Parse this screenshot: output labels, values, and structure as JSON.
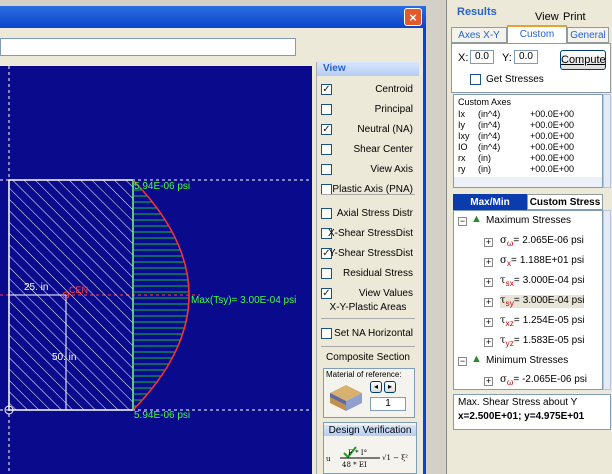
{
  "window": {
    "close_label": "×"
  },
  "canvas": {
    "top_stress": "5.94E-06 psi",
    "bottom_stress": "5.94E-06 psi",
    "max_label": "Max(Tsy)= 3.00E-04 psi",
    "dim_width": "25. in",
    "dim_height": "50. in",
    "na_label": "CEN",
    "colors": {
      "background": "#0a0a8c",
      "section": "#ffffff",
      "fill": "#10c040",
      "curve": "#ff3030"
    }
  },
  "view_panel": {
    "title": "View",
    "items": [
      {
        "label": "Centroid",
        "checked": true
      },
      {
        "label": "Principal",
        "checked": false
      },
      {
        "label": "Neutral (NA)",
        "checked": true
      },
      {
        "label": "Shear Center",
        "checked": false
      },
      {
        "label": "View  Axis",
        "checked": false
      },
      {
        "label": "Plastic Axis (PNA)",
        "checked": false
      },
      {
        "label": "Axial Stress Distr",
        "checked": false
      },
      {
        "label": "X-Shear StressDist",
        "checked": false
      },
      {
        "label": "Y-Shear StressDist",
        "checked": true
      },
      {
        "label": "Residual Stress",
        "checked": false
      },
      {
        "label": "View Values",
        "checked": true
      }
    ],
    "xy_plastic": "X-Y-Plastic Areas",
    "set_na": "Set NA Horizontal",
    "composite": "Composite Section",
    "material_label": "Material of reference:",
    "material_value": "1",
    "design": "Design Verification"
  },
  "right_panel": {
    "results": "Results",
    "view": "View",
    "print": "Print",
    "tabs": [
      "Axes X-Y",
      "Custom axes",
      "General"
    ],
    "x_label": "X:",
    "x_value": "0.0",
    "y_label": "Y:",
    "y_value": "0.0",
    "compute": "Compute",
    "get_stresses": "Get Stresses",
    "custom_axes_title": "Custom Axes",
    "props": [
      {
        "name": "Ix",
        "unit": "(in^4)",
        "value": "+00.0E+00"
      },
      {
        "name": "Iy",
        "unit": "(in^4)",
        "value": "+00.0E+00"
      },
      {
        "name": "Ixy",
        "unit": "(in^4)",
        "value": "+00.0E+00"
      },
      {
        "name": "IO",
        "unit": "(in^4)",
        "value": "+00.0E+00"
      },
      {
        "name": "rx",
        "unit": "(in)",
        "value": "+00.0E+00"
      },
      {
        "name": "ry",
        "unit": "(in)",
        "value": "+00.0E+00"
      }
    ],
    "stress_tabs": [
      "Max/Min Stress",
      "Custom Stress"
    ],
    "max_stresses": "Maximum Stresses",
    "min_stresses": "Minimum Stresses",
    "stresses": [
      {
        "sym": "σ",
        "sub": "ω",
        "eq": "=",
        "value": "2.065E-06 psi"
      },
      {
        "sym": "σ",
        "sub": "x",
        "eq": "=",
        "value": "1.188E+01 psi"
      },
      {
        "sym": "τ",
        "sub": "sx",
        "eq": "=",
        "value": "3.000E-04 psi"
      },
      {
        "sym": "τ",
        "sub": "sy",
        "eq": "=",
        "value": "3.000E-04 psi"
      },
      {
        "sym": "τ",
        "sub": "xz",
        "eq": "=",
        "value": "1.254E-05 psi"
      },
      {
        "sym": "τ",
        "sub": "yz",
        "eq": "=",
        "value": "1.583E-05 psi"
      }
    ],
    "min_stress": {
      "sym": "σ",
      "sub": "ω",
      "eq": "=",
      "value": "-2.065E-06 psi"
    },
    "footer_title": "Max. Shear Stress about Y",
    "footer_x": "x=2.500E+01",
    "footer_sep": "; ",
    "footer_y": "y=4.975E+01"
  }
}
